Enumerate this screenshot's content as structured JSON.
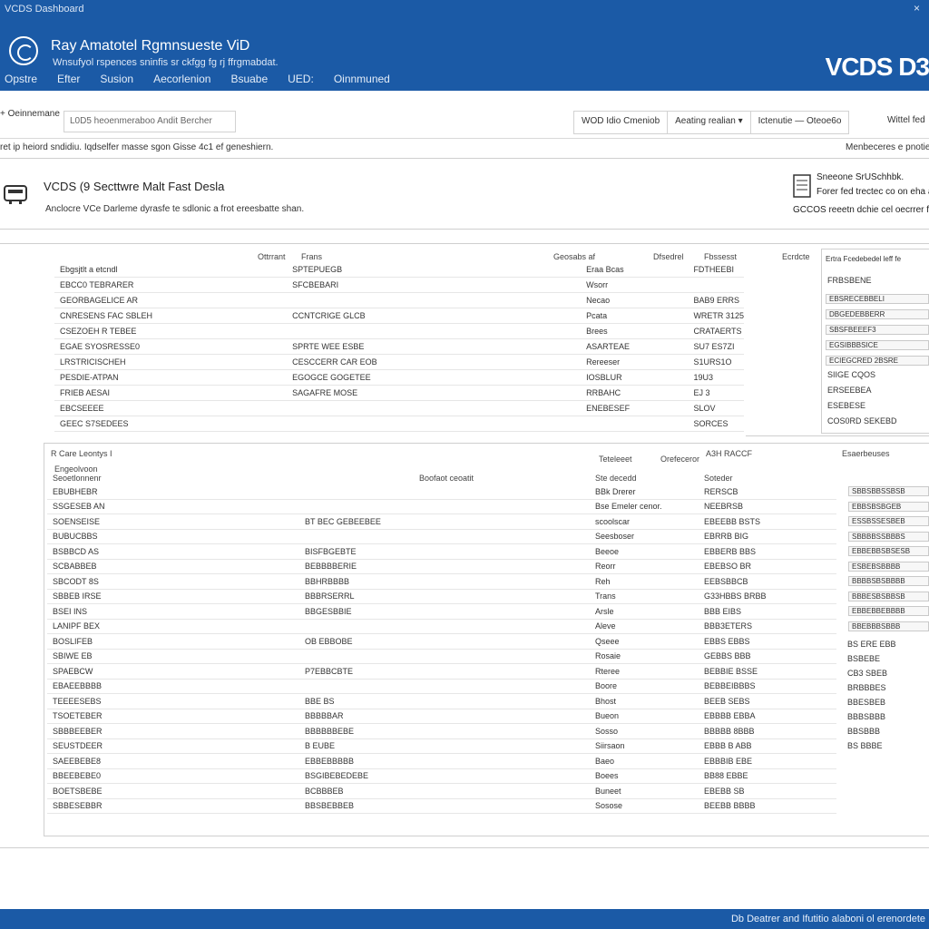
{
  "window": {
    "title": "VCDS Dashboard",
    "close_glyph": "×"
  },
  "header": {
    "title": "Ray Amatotel Rgmnsueste ViD",
    "subtitle": "Wnsufyol rspences sninfis sr ckfgg fg rj ffrgmabdat.",
    "brand": "VCDS D3",
    "logo_icon": "steering-wheel-icon",
    "menu": [
      "Opstre",
      "Efter",
      "Susion",
      "Aecorlenion",
      "Bsuabe",
      "UED:",
      "Oinnmuned"
    ]
  },
  "toolbar": {
    "left_label": "+ Oeinnemane",
    "search_value": "L0D5 heoenmeraboo  Andit  Bercher",
    "group": [
      "WOD  Idio  Cmeniob",
      "Aeating realian ▾",
      "Ictenutie  —  Oteoe6o"
    ],
    "right_label": "Wittel fed"
  },
  "subbar": {
    "left": "ret ip heiord sndidiu.    Iqdselfer masse sgon Gisse 4c1 ef geneshiern.",
    "right": "Menbeceres e pnotiear"
  },
  "info": {
    "title": "VCDS (9 Secttwre Malt Fast Desla",
    "description": "Anclocre VCe Darleme dyrasfe te sdlonic a frot ereesbatte shan.",
    "right_line1": "Sneeone SrUSchhbk.",
    "right_line2": "Forer fed trectec co on eha acet",
    "right_line3": "GCCOS reeetn dchie cel oecrrer for",
    "vehicle_icon": "vehicle-interface-icon",
    "doc_icon": "document-icon"
  },
  "table1": {
    "headers": [
      "Ottrrant",
      "Frans",
      "Geosabs af",
      "Dfsedrel",
      "Fbssesst",
      "Ecrdcte"
    ],
    "rows": [
      [
        "Ebgsjtlt a etcndl",
        "SPTEPUEGB",
        "Eraa Bcas",
        "FDTHEEBI"
      ],
      [
        "EBCC0 TEBRARER",
        "SFCBEBARI",
        "Wsorr",
        ""
      ],
      [
        "GEORBAGELICE AR",
        "",
        "Necao",
        "BAB9 ERRS"
      ],
      [
        "CNRESENS FAC SBLEH",
        "CCNTCRIGE GLCB",
        "Pcata",
        "WRETR 3125"
      ],
      [
        "CSEZOEH R TEBEE",
        "",
        "Brees",
        "CRATAERTS"
      ],
      [
        "EGAE SYOSRESSE0",
        "SPRTE WEE ESBE",
        "ASARTEAE",
        "SU7 ES7ZI"
      ],
      [
        "LRSTRICISCHEH",
        "CESCCERR CAR EOB",
        "Rereeser",
        "S1URS1O"
      ],
      [
        "PESDIE-ATPAN",
        "EGOGCE GOGETEE",
        "IOSBLUR",
        "19U3"
      ],
      [
        "FRIEB AESAI",
        "SAGAFRE MOSE",
        "RRBAHC",
        "EJ 3"
      ],
      [
        "EBCSEEEE",
        "",
        "ENEBESEF",
        "SLOV"
      ],
      [
        "GEEC S7SEDEES",
        "",
        "",
        "SORCES"
      ]
    ]
  },
  "side1": {
    "header": "Ertra Fcedebedel leff fe",
    "title": "FRBSBENE",
    "fields": [
      "EBSRECEBBELI",
      "DBGEDEBBERR",
      "SBSFBEEEF3",
      "EGSIBBBSICE",
      "ECIEGCRED 2BSRE"
    ],
    "rows": [
      "SIIGE CQOS",
      "ERSEEBEA",
      "ESEBESE",
      "COS0RD SEKEBD"
    ]
  },
  "table2": {
    "title": "R Care Leontys I",
    "subtitle": "Engeolvoon",
    "col0": "Seoetlonnenr",
    "col1": "Boofaot ceoatit",
    "col2": "Ste decedd",
    "col3": "Soteder",
    "col4": "Esaerbeuses",
    "mid_header1": "Teteleeet",
    "mid_header2": "Orefeceror",
    "mid_header3": "A3H RACCF",
    "rows": [
      [
        "EBUBHEBR",
        "",
        "BBk Drerer",
        "RERSCB"
      ],
      [
        "SSGESEB AN",
        "",
        "Bse Emeler cenor.",
        "NEEBRSB"
      ],
      [
        "SOENSEISE",
        "BT BEC GEBEEBEE",
        "scoolscar",
        "EBEEBB BSTS"
      ],
      [
        "BUBUCBBS",
        "",
        "Seesboser",
        "EBRRB BIG"
      ],
      [
        "BSBBCD AS",
        "BISFBGEBTE",
        "Beeoe",
        "EBBERB BBS"
      ],
      [
        "SCBABBEB",
        "BEBBBBERIE",
        "Reorr",
        "EBEBSO BR"
      ],
      [
        "SBCODT 8S",
        "BBHRBBBB",
        "Reh",
        "EEBSBBCB"
      ],
      [
        "SBBEB IRSE",
        "BBBRSERRL",
        "Trans",
        "G33HBBS BRBB"
      ],
      [
        "BSEI INS",
        "BBGESBBIE",
        "Arsle",
        "BBB EIBS"
      ],
      [
        "LANIPF BEX",
        "",
        "Aleve",
        "BBB3ETERS"
      ],
      [
        "BOSLIFEB",
        "OB EBBOBE",
        "Qseee",
        "EBBS EBBS"
      ],
      [
        "SBIWE EB",
        "",
        "Rosaie",
        "GEBBS BBB"
      ],
      [
        "SPAEBCW",
        "P7EBBCBTE",
        "Rteree",
        "BEBBIE BSSE"
      ],
      [
        "EBAEEBBBB",
        "",
        "Boore",
        "BEBBEIBBBS"
      ],
      [
        "TEEEESEBS",
        "BBE BS",
        "Bhost",
        "BEEB SEBS"
      ],
      [
        "TSOETEBER",
        "BBBBBAR",
        "Bueon",
        "EBBBB EBBA"
      ],
      [
        "SBBBEEBER",
        "BBBBBBEBE",
        "Sosso",
        "BBBBB 8BBB"
      ],
      [
        "SEUSTDEER",
        "B EUBE",
        "Siirsaon",
        "EBBB B ABB"
      ],
      [
        "SAEEBEBE8",
        "EBBEBBBBB",
        "Baeo",
        "EBBBIB EBE"
      ],
      [
        "BBEEBEBE0",
        "BSGIBEBEDEBE",
        "Boees",
        "BB88 EBBE"
      ],
      [
        "BOETSBEBE",
        "BCBBBEB",
        "Buneet",
        "EBEBB SB"
      ],
      [
        "SBBESEBBR",
        "BBSBEBBEB",
        "Sosose",
        "BEEBB BBBB"
      ]
    ]
  },
  "side2": {
    "fields": [
      "SBBSBBSSBSB",
      "EBBSBSBGEB",
      "ESSBSSESBEB",
      "SBBBBSSBBBS",
      "EBBEBBSBSESB",
      "ESBEBSBBBB",
      "BBBBSBSBBBB",
      "BBBESBSBBSB",
      "EBBEBBEBBBB",
      "BBEBBBSBBB"
    ],
    "rows": [
      "BS ERE EBB",
      "BSBEBE",
      "CB3 SBEB",
      "BRBBBES",
      "BBESBEB",
      "BBBSBBB",
      "BBSBBB",
      "BS BBBE"
    ]
  },
  "footer": {
    "text": "Db Deatrer and Ifutitio alaboni ol erenordete"
  }
}
